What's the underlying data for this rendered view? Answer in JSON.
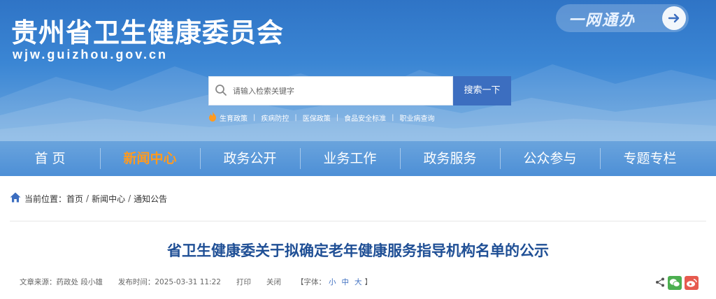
{
  "header": {
    "site_title": "贵州省卫生健康委员会",
    "site_domain": "wjw.guizhou.gov.cn",
    "yiwang_label": "一网通办"
  },
  "search": {
    "placeholder": "请输入检索关键字",
    "button_label": "搜索一下",
    "hot_links": [
      "生育政策",
      "疾病防控",
      "医保政策",
      "食品安全标准",
      "职业病查询"
    ]
  },
  "nav": {
    "items": [
      "首  页",
      "新闻中心",
      "政务公开",
      "业务工作",
      "政务服务",
      "公众参与",
      "专题专栏"
    ],
    "active_index": 1
  },
  "breadcrumb": {
    "prefix": "当前位置：",
    "items": [
      "首页",
      "新闻中心",
      "通知公告"
    ],
    "separator": "/"
  },
  "article": {
    "title": "省卫生健康委关于拟确定老年健康服务指导机构名单的公示",
    "source": "文章来源：药政处 段小雄",
    "date": "发布时间：2025-03-31 11:22",
    "print_label": "打印",
    "close_label": "关闭",
    "font_prefix": "【字体：",
    "font_small": "小",
    "font_medium": "中",
    "font_large": "大",
    "font_suffix": "】"
  },
  "colors": {
    "brand_blue": "#3c6ec0",
    "title_blue": "#1f4f95",
    "nav_active": "#ff9a1f",
    "wechat_green": "#4caf50",
    "weibo_red": "#e65a4f"
  },
  "icons": [
    "search-icon",
    "arrow-right-icon",
    "flame-icon",
    "home-icon",
    "share-icon",
    "wechat-icon",
    "weibo-icon"
  ]
}
